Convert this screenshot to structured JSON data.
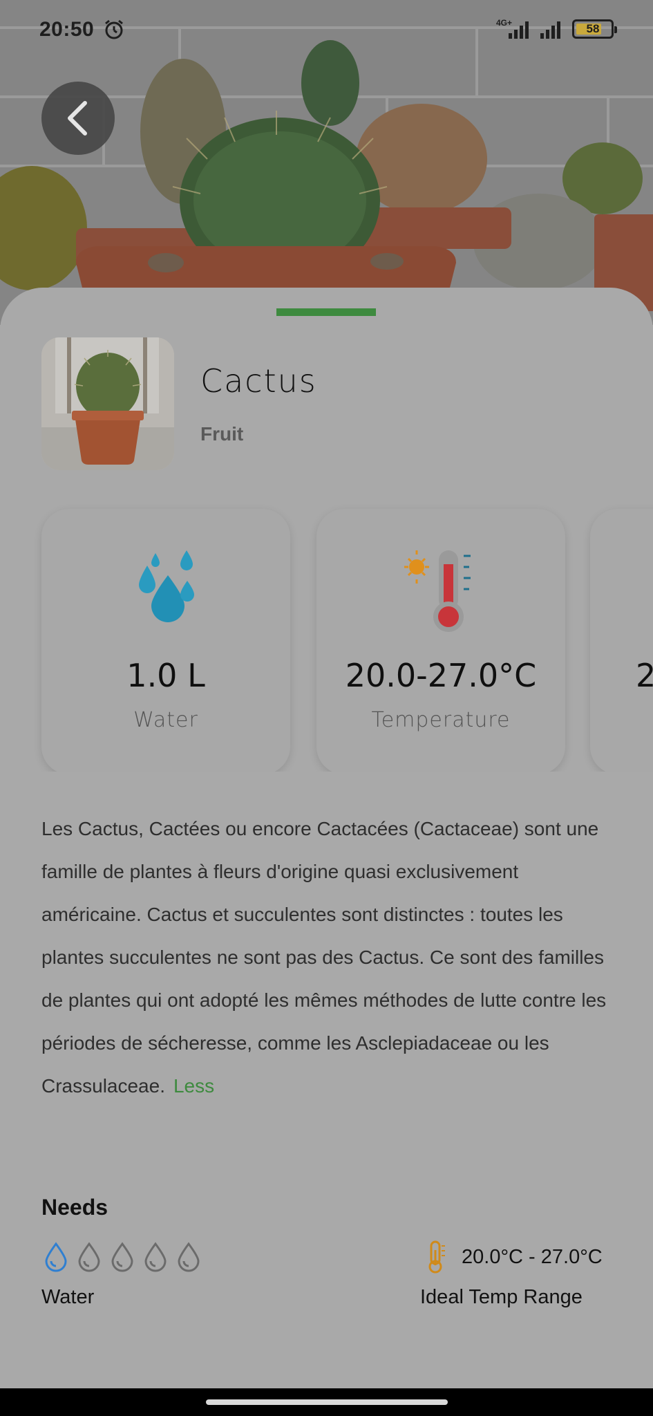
{
  "status_bar": {
    "time": "20:50",
    "network": "4G+",
    "battery": "58"
  },
  "hero": {
    "icon": "cactus-photo",
    "back_icon": "chevron-left-icon"
  },
  "plant": {
    "name": "Cactus",
    "category": "Fruit"
  },
  "stats": [
    {
      "value": "1.0 L",
      "label": "Water",
      "icon": "water-drops-icon"
    },
    {
      "value": "20.0-27.0°C",
      "label": "Temperature",
      "icon": "thermometer-icon"
    },
    {
      "value": "2",
      "label": "",
      "icon": ""
    }
  ],
  "description": {
    "text": "Les Cactus, Cactées ou encore Cactacées (Cactaceae) sont une famille de plantes à fleurs d'origine quasi exclusivement américaine. Cactus et succulentes sont distinctes : toutes les plantes succulentes ne sont pas des Cactus. Ce sont des familles de plantes qui ont adopté les mêmes méthodes de lutte contre les périodes de sécheresse, comme les Asclepiadaceae ou les Crassulaceae.",
    "toggle": "Less"
  },
  "needs": {
    "title": "Needs",
    "water": {
      "label": "Water",
      "level": 1,
      "max": 5
    },
    "temperature": {
      "value": "20.0°C - 27.0°C",
      "label": "Ideal Temp Range"
    }
  },
  "colors": {
    "accent": "#3e8a3f",
    "drop_active": "#2f7fd1",
    "drop_inactive": "#6b6b6b",
    "thermo": "#d08a1a"
  }
}
